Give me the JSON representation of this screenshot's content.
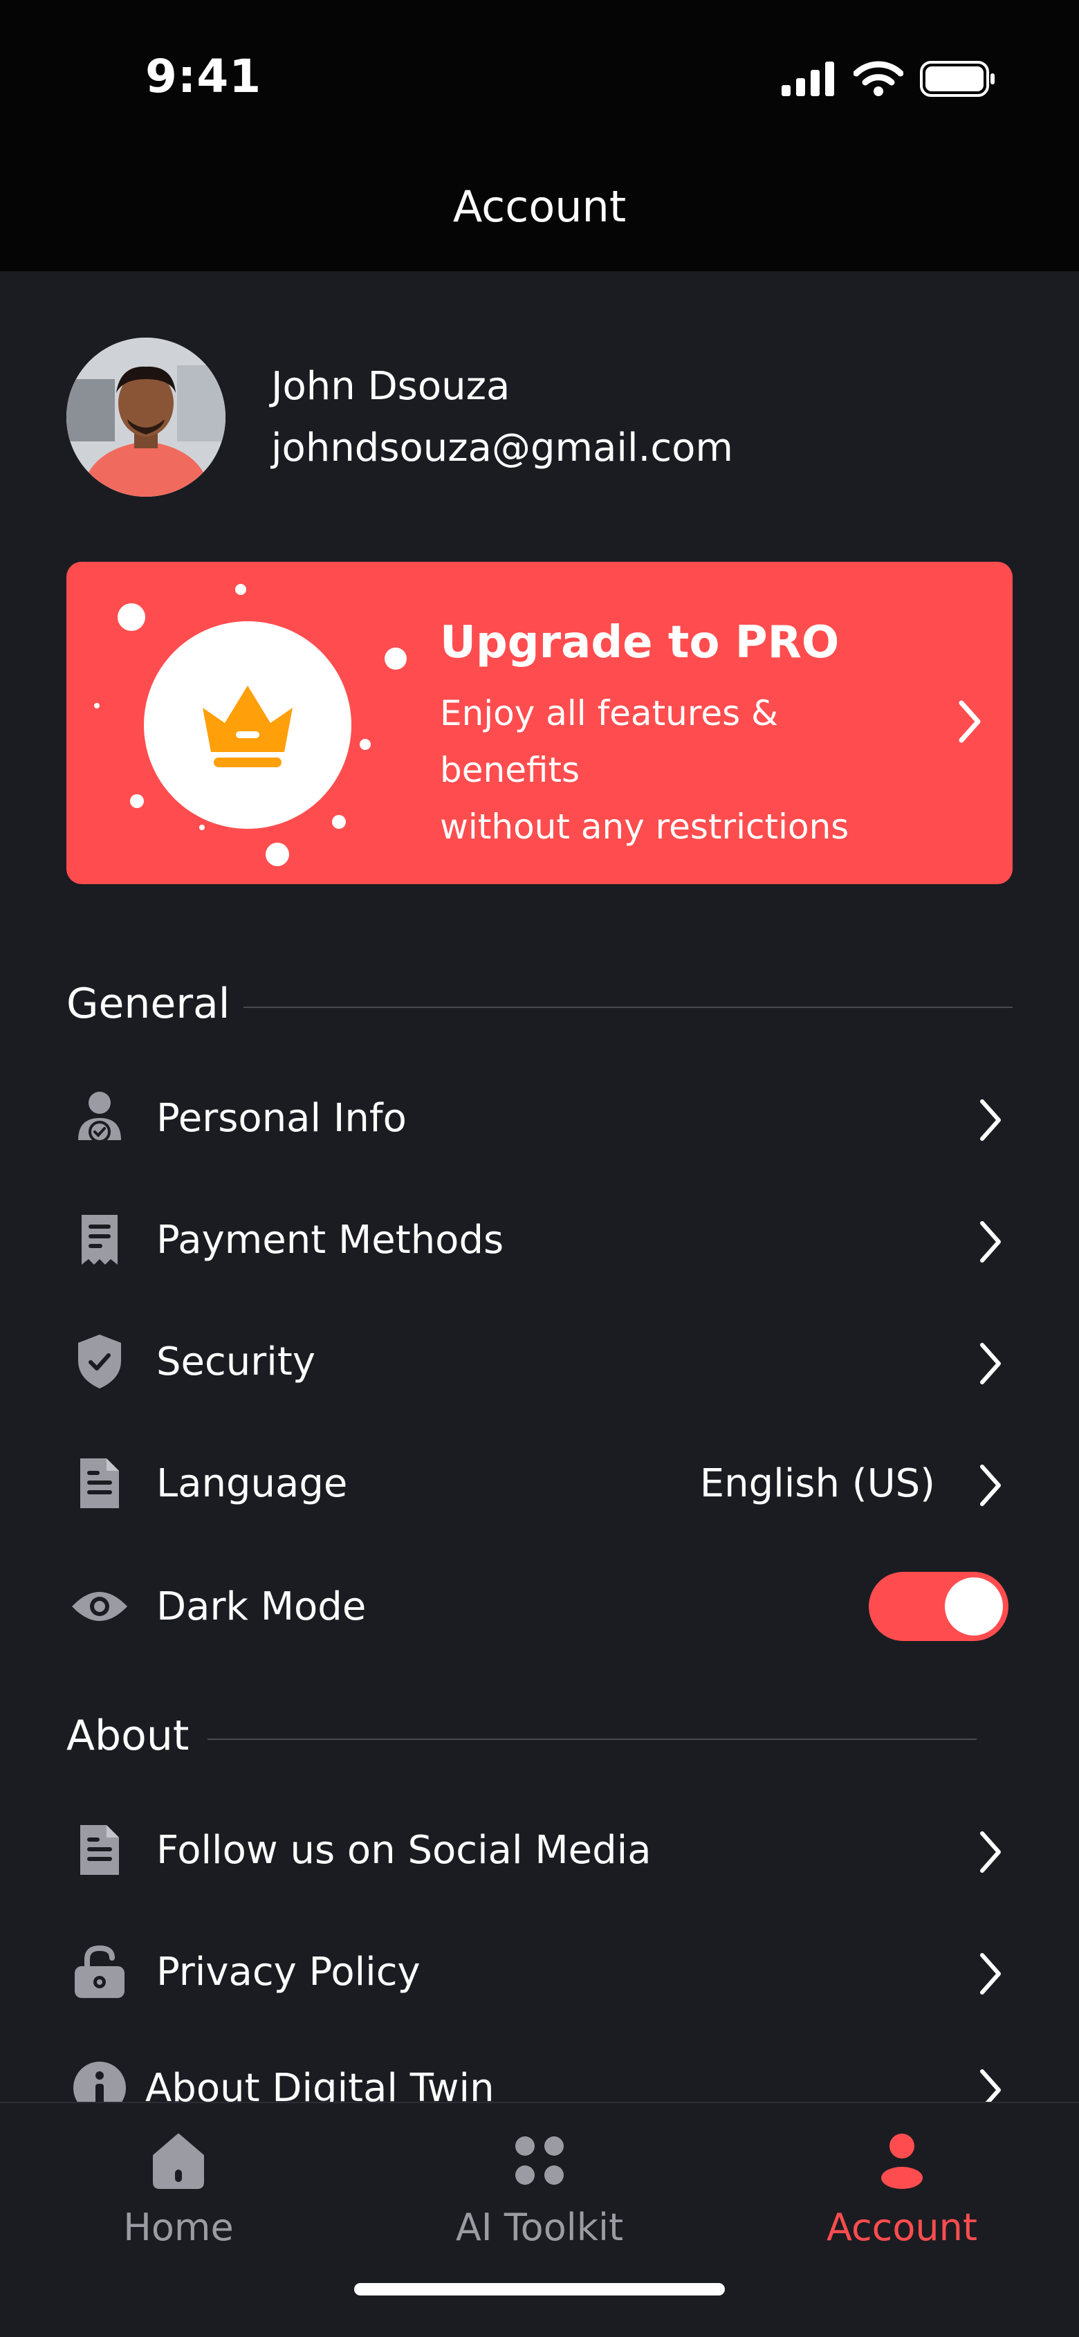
{
  "status_bar": {
    "time": "9:41"
  },
  "header": {
    "title": "Account"
  },
  "profile": {
    "name": "John Dsouza",
    "email": "johndsouza@gmail.com"
  },
  "upgrade": {
    "title": "Upgrade to PRO",
    "subtitle_line1": "Enjoy all features & benefits",
    "subtitle_line2": "without any restrictions"
  },
  "general": {
    "title": "General",
    "items": [
      {
        "label": "Personal Info",
        "icon": "person-check-icon"
      },
      {
        "label": "Payment Methods",
        "icon": "receipt-icon"
      },
      {
        "label": "Security",
        "icon": "shield-check-icon"
      },
      {
        "label": "Language",
        "value": "English (US)",
        "icon": "document-icon"
      },
      {
        "label": "Dark Mode",
        "icon": "eye-icon",
        "toggle_on": true
      }
    ]
  },
  "about": {
    "title": "About",
    "items": [
      {
        "label": "Follow us on Social Media",
        "icon": "document-icon"
      },
      {
        "label": "Privacy Policy",
        "icon": "lock-icon"
      },
      {
        "label": "About Digital Twin",
        "icon": "info-icon"
      }
    ]
  },
  "tabbar": {
    "tabs": [
      {
        "label": "Home",
        "icon": "home-icon"
      },
      {
        "label": "AI Toolkit",
        "icon": "grid-dots-icon"
      },
      {
        "label": "Account",
        "icon": "person-icon",
        "active": true
      }
    ]
  },
  "colors": {
    "accent": "#ff4d4f",
    "background": "#1b1c21",
    "crown": "#ff9f0a",
    "icon_gray": "#9b9ca3"
  }
}
